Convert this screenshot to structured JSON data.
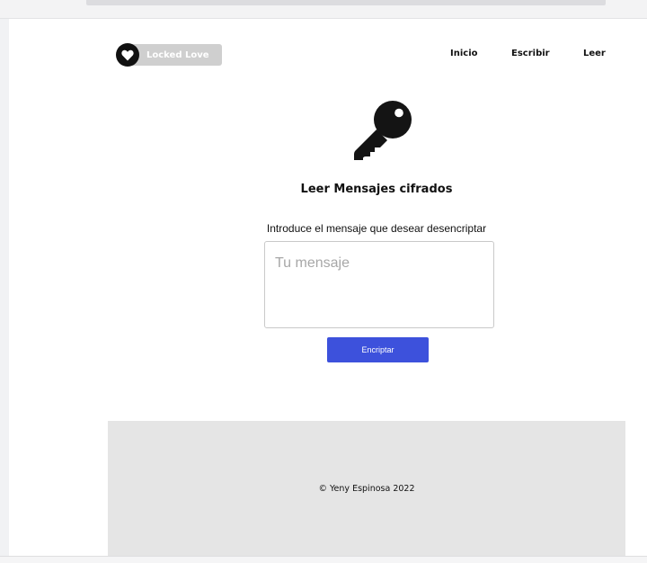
{
  "header": {
    "brand": "Locked Love",
    "nav": [
      {
        "label": "Inicio"
      },
      {
        "label": "Escribir"
      },
      {
        "label": "Leer"
      }
    ]
  },
  "main": {
    "icon": "key-icon",
    "title": "Leer Mensajes cifrados",
    "instruction": "Introduce el mensaje que desear desencriptar",
    "message_input": {
      "value": "",
      "placeholder": "Tu mensaje"
    },
    "submit_label": "Encriptar"
  },
  "footer": {
    "text": "© Yeny Espinosa 2022"
  },
  "colors": {
    "button": "#3d51dc",
    "footer_bg": "#e5e5e5",
    "logo_pill": "#cfcfcf",
    "text": "#111111"
  }
}
